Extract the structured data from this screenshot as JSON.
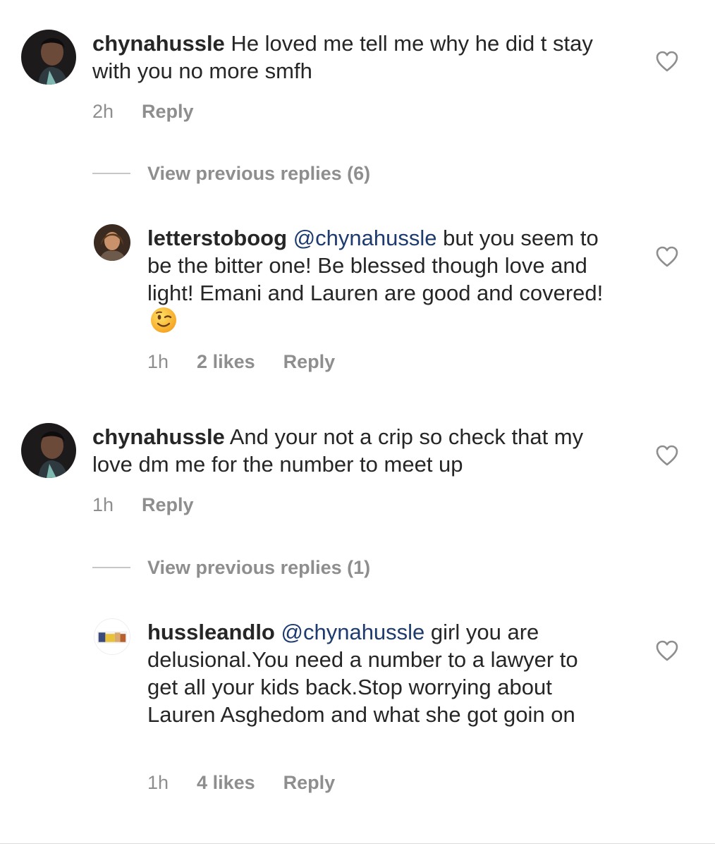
{
  "comments": [
    {
      "username": "chynahussle",
      "text": " He loved me tell me why he did t stay with you no more smfh",
      "time": "2h",
      "reply_label": "Reply",
      "view_replies_label": "View previous replies (6)"
    },
    {
      "username": "letterstoboog",
      "mention": "@chynahussle",
      "text": " but you seem to be the bitter one! Be blessed though love and light! Emani and Lauren are good and covered! ",
      "emoji": "winking-face",
      "time": "1h",
      "likes": "2 likes",
      "reply_label": "Reply"
    },
    {
      "username": "chynahussle",
      "text": " And your not a crip  so check that my love dm me for the number to meet up",
      "time": "1h",
      "reply_label": "Reply",
      "view_replies_label": "View previous replies (1)"
    },
    {
      "username": "hussleandlo",
      "mention": "@chynahussle",
      "text": " girl you are delusional.You need a number to a lawyer to get all your kids back.Stop worrying about Lauren Asghedom and what she got goin on",
      "time": "1h",
      "likes": "4 likes",
      "reply_label": "Reply"
    }
  ],
  "icons": {
    "like": "heart-outline-icon"
  },
  "colors": {
    "text": "#262626",
    "meta": "#8e8e8e",
    "mention": "#1d3b6f"
  }
}
